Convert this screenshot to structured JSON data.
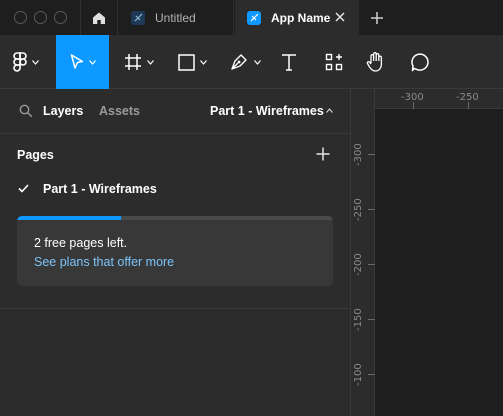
{
  "window": {
    "tabs": [
      {
        "label": "Untitled",
        "active": false
      },
      {
        "label": "App Name",
        "active": true
      }
    ]
  },
  "toolbar": {
    "tools": [
      {
        "icon": "figma-menu-icon",
        "dropdown": true
      },
      {
        "icon": "move-tool-icon",
        "dropdown": true,
        "active": true
      },
      {
        "icon": "frame-tool-icon",
        "dropdown": true
      },
      {
        "icon": "rectangle-tool-icon",
        "dropdown": true
      },
      {
        "icon": "pen-tool-icon",
        "dropdown": true
      },
      {
        "icon": "text-tool-icon",
        "dropdown": false
      },
      {
        "icon": "resources-icon",
        "dropdown": false
      },
      {
        "icon": "hand-tool-icon",
        "dropdown": false
      },
      {
        "icon": "comment-tool-icon",
        "dropdown": false
      }
    ],
    "accent": "#0d99ff"
  },
  "panel": {
    "tabs": {
      "layers": "Layers",
      "assets": "Assets"
    },
    "current_page": "Part 1 - Wireframes",
    "pages_heading": "Pages",
    "pages": [
      {
        "label": "Part 1 - Wireframes",
        "selected": true
      }
    ],
    "upsell": {
      "usage_fraction": 0.33,
      "message": "2 free pages left.",
      "link": "See plans that offer more"
    }
  },
  "rulers": {
    "horizontal": [
      "-300",
      "-250"
    ],
    "vertical": [
      "-300",
      "-250",
      "-200",
      "-150",
      "-100"
    ]
  },
  "colors": {
    "titlebar": "#1e1e1e",
    "panel": "#2c2c2c",
    "canvas": "#1e1e1e",
    "link": "#7cc4fa"
  }
}
